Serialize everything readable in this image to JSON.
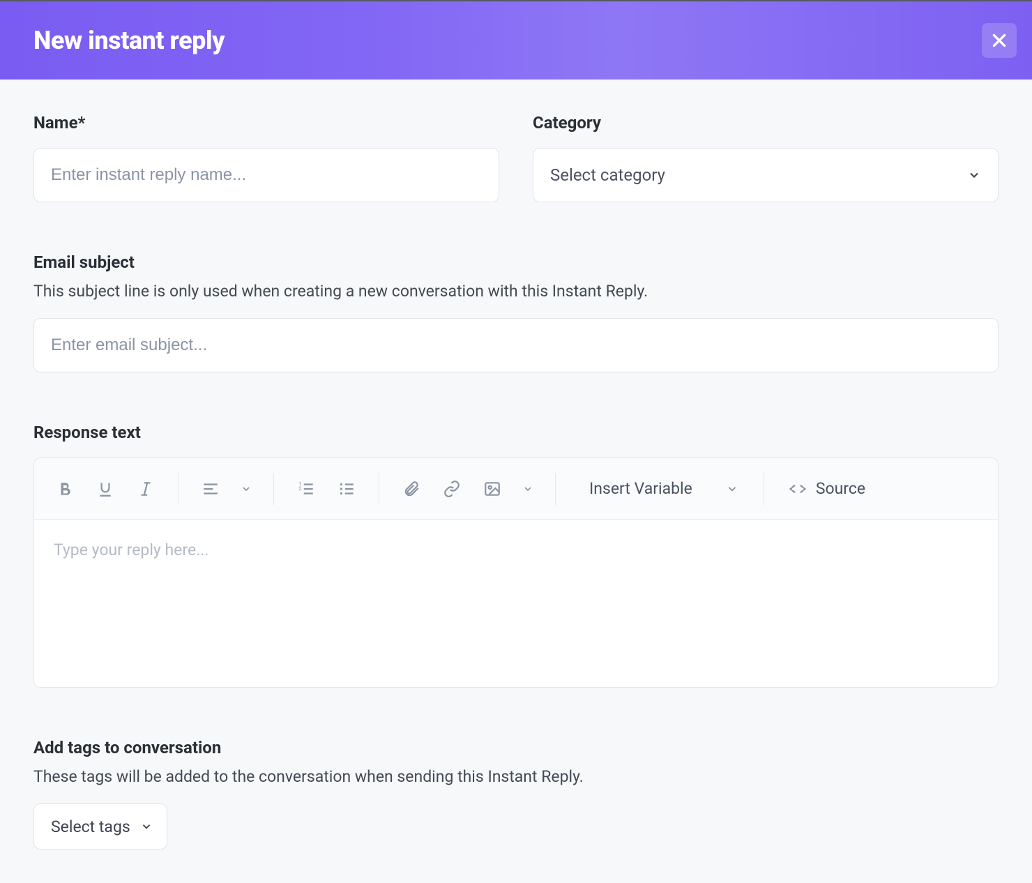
{
  "header": {
    "title": "New instant reply"
  },
  "name": {
    "label": "Name*",
    "placeholder": "Enter instant reply name..."
  },
  "category": {
    "label": "Category",
    "placeholder": "Select category"
  },
  "emailSubject": {
    "label": "Email subject",
    "help": "This subject line is only used when creating a new conversation with this Instant Reply.",
    "placeholder": "Enter email subject..."
  },
  "responseText": {
    "label": "Response text",
    "placeholder": "Type your reply here..."
  },
  "toolbar": {
    "insert_variable": "Insert Variable",
    "source": "Source"
  },
  "tags": {
    "label": "Add tags to conversation",
    "help": "These tags will be added to the conversation when sending this Instant Reply.",
    "placeholder": "Select tags"
  }
}
